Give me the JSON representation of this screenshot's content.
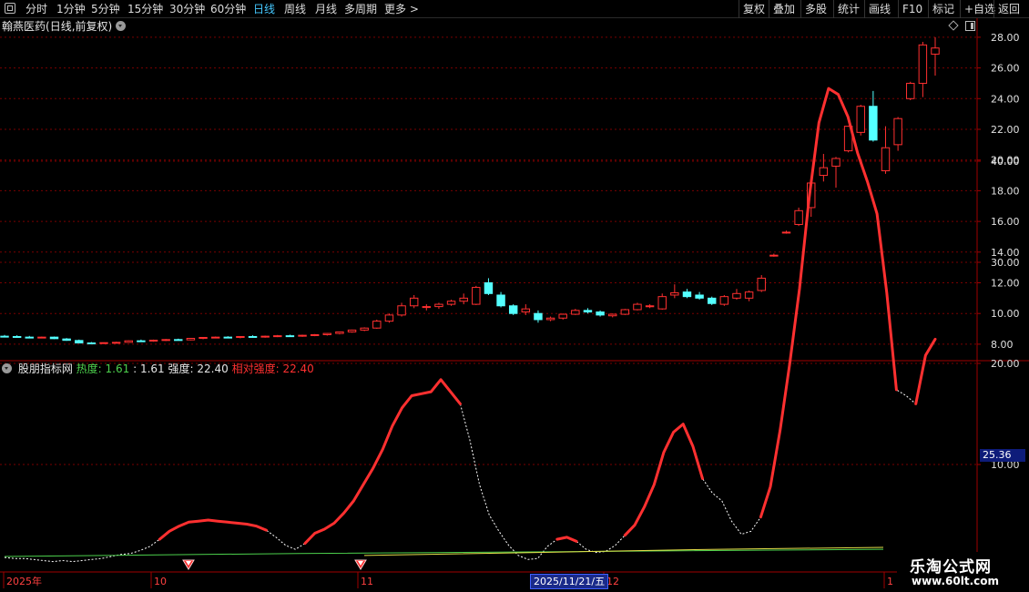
{
  "toolbar": {
    "left": [
      "分时",
      "1分钟",
      "5分钟",
      "15分钟",
      "30分钟",
      "60分钟",
      "日线",
      "周线",
      "月线",
      "多周期",
      "更多 >"
    ],
    "active": "日线",
    "right": [
      "复权",
      "叠加",
      "多股",
      "统计",
      "画线",
      "F10",
      "标记",
      "+自选",
      "返回"
    ]
  },
  "stock": {
    "name": "翰燕医药",
    "mode": "(日线,前复权)"
  },
  "indicator": {
    "name": "股朋指标网",
    "heat_label": "热度:",
    "heat_value": "1.61",
    "colon_value": ": 1.61",
    "strength_label": "强度:",
    "strength_value": "22.40",
    "rel_label": "相对强度:",
    "rel_value": "22.40",
    "last_value": "25.36"
  },
  "price_axis": [
    "28.00",
    "26.00",
    "24.00",
    "22.00",
    "20.00",
    "18.00",
    "16.00",
    "14.00",
    "12.00",
    "10.00",
    "8.00"
  ],
  "ind_axis": [
    "40.00",
    "30.00",
    "20.00",
    "10.00"
  ],
  "date_axis": [
    "2025年",
    "10",
    "11",
    "12",
    "1"
  ],
  "crosshair_date": "2025/11/21/五",
  "brand": {
    "line1": "乐淘公式网",
    "line2": "www.60lt.com"
  },
  "colors": {
    "up": "#ff3030",
    "down": "#54ffff",
    "grid": "#7a0000",
    "active": "#45c8ff",
    "heat": "#4cd04c",
    "rel": "#ff3030"
  },
  "chart_data": {
    "type": "candlestick",
    "price_range": [
      7.0,
      28.9
    ],
    "ohlc": [
      [
        8.52,
        8.6,
        8.45,
        8.5
      ],
      [
        8.5,
        8.58,
        8.42,
        8.46
      ],
      [
        8.46,
        8.54,
        8.4,
        8.44
      ],
      [
        8.42,
        8.5,
        8.38,
        8.46
      ],
      [
        8.46,
        8.5,
        8.33,
        8.36
      ],
      [
        8.34,
        8.4,
        8.22,
        8.25
      ],
      [
        8.24,
        8.3,
        8.05,
        8.08
      ],
      [
        8.08,
        8.14,
        8.02,
        8.06
      ],
      [
        8.06,
        8.12,
        8.02,
        8.1
      ],
      [
        8.1,
        8.16,
        8.05,
        8.12
      ],
      [
        8.12,
        8.25,
        8.1,
        8.22
      ],
      [
        8.22,
        8.3,
        8.15,
        8.2
      ],
      [
        8.2,
        8.3,
        8.16,
        8.26
      ],
      [
        8.26,
        8.34,
        8.2,
        8.3
      ],
      [
        8.3,
        8.36,
        8.24,
        8.28
      ],
      [
        8.28,
        8.4,
        8.25,
        8.38
      ],
      [
        8.38,
        8.46,
        8.32,
        8.44
      ],
      [
        8.44,
        8.5,
        8.38,
        8.46
      ],
      [
        8.46,
        8.52,
        8.4,
        8.44
      ],
      [
        8.44,
        8.52,
        8.38,
        8.5
      ],
      [
        8.5,
        8.58,
        8.44,
        8.48
      ],
      [
        8.48,
        8.56,
        8.42,
        8.52
      ],
      [
        8.52,
        8.6,
        8.46,
        8.55
      ],
      [
        8.55,
        8.62,
        8.5,
        8.52
      ],
      [
        8.52,
        8.62,
        8.48,
        8.58
      ],
      [
        8.58,
        8.66,
        8.52,
        8.62
      ],
      [
        8.62,
        8.72,
        8.56,
        8.7
      ],
      [
        8.7,
        8.82,
        8.64,
        8.8
      ],
      [
        8.8,
        8.95,
        8.75,
        8.92
      ],
      [
        8.92,
        9.1,
        8.85,
        9.05
      ],
      [
        9.05,
        9.6,
        9.0,
        9.5
      ],
      [
        9.5,
        10.0,
        9.4,
        9.9
      ],
      [
        9.9,
        10.7,
        9.8,
        10.5
      ],
      [
        10.5,
        11.2,
        10.35,
        11.0
      ],
      [
        10.4,
        10.6,
        10.2,
        10.45
      ],
      [
        10.45,
        10.7,
        10.3,
        10.6
      ],
      [
        10.6,
        10.9,
        10.5,
        10.8
      ],
      [
        10.8,
        11.3,
        10.6,
        11.0
      ],
      [
        10.6,
        11.8,
        10.55,
        11.7
      ],
      [
        12.0,
        12.3,
        11.2,
        11.3
      ],
      [
        11.2,
        11.4,
        10.4,
        10.5
      ],
      [
        10.5,
        10.6,
        9.9,
        10.0
      ],
      [
        10.1,
        10.6,
        9.9,
        10.3
      ],
      [
        10.0,
        10.2,
        9.4,
        9.6
      ],
      [
        9.6,
        9.8,
        9.5,
        9.7
      ],
      [
        9.7,
        10.0,
        9.6,
        9.95
      ],
      [
        9.95,
        10.3,
        9.9,
        10.2
      ],
      [
        10.2,
        10.35,
        10.0,
        10.1
      ],
      [
        10.1,
        10.2,
        9.8,
        9.9
      ],
      [
        9.85,
        10.0,
        9.75,
        9.95
      ],
      [
        9.95,
        10.3,
        9.9,
        10.25
      ],
      [
        10.25,
        10.7,
        10.2,
        10.6
      ],
      [
        10.45,
        10.6,
        10.35,
        10.5
      ],
      [
        10.3,
        11.3,
        10.25,
        11.1
      ],
      [
        11.2,
        11.9,
        11.0,
        11.35
      ],
      [
        11.4,
        11.6,
        11.0,
        11.1
      ],
      [
        11.2,
        11.4,
        10.9,
        11.0
      ],
      [
        11.0,
        11.1,
        10.55,
        10.65
      ],
      [
        10.6,
        11.2,
        10.5,
        11.1
      ],
      [
        11.0,
        11.6,
        10.9,
        11.3
      ],
      [
        11.0,
        11.5,
        10.8,
        11.4
      ],
      [
        11.5,
        12.5,
        11.4,
        12.3
      ],
      [
        13.8,
        13.9,
        13.7,
        13.8
      ],
      [
        15.3,
        15.4,
        15.2,
        15.3
      ],
      [
        15.8,
        16.9,
        15.7,
        16.7
      ],
      [
        16.9,
        18.7,
        16.3,
        18.5
      ],
      [
        19.0,
        20.4,
        18.6,
        19.5
      ],
      [
        19.6,
        20.2,
        18.2,
        20.1
      ],
      [
        20.6,
        22.1,
        20.5,
        22.2
      ],
      [
        21.8,
        23.6,
        21.6,
        23.5
      ],
      [
        23.5,
        24.5,
        21.2,
        21.3
      ],
      [
        19.3,
        22.2,
        19.1,
        20.8
      ],
      [
        21.0,
        22.8,
        20.6,
        22.7
      ],
      [
        24.0,
        25.1,
        23.9,
        25.0
      ],
      [
        25.0,
        27.7,
        24.1,
        27.5
      ],
      [
        26.9,
        28.0,
        25.5,
        27.3
      ]
    ],
    "indicator_range": [
      0,
      48.0
    ],
    "strength_line": [
      0.8,
      0.7,
      0.7,
      0.6,
      0.5,
      0.4,
      0.5,
      0.4,
      0.5,
      0.6,
      0.7,
      0.9,
      1.1,
      1.2,
      1.5,
      1.9,
      2.6,
      3.4,
      3.9,
      4.3,
      4.4,
      4.5,
      4.4,
      4.3,
      4.2,
      4.1,
      3.9,
      3.5,
      2.8,
      2.0,
      1.6,
      2.2,
      3.2,
      3.6,
      4.2,
      5.2,
      6.4,
      8.0,
      9.6,
      11.5,
      13.8,
      15.6,
      16.8,
      17.0,
      17.2,
      18.4,
      17.2,
      16.0,
      12.4,
      8.0,
      5.0,
      3.4,
      2.0,
      1.0,
      0.6,
      0.7,
      1.9,
      2.6,
      2.8,
      2.4,
      1.6,
      1.3,
      1.4,
      2.0,
      3.0,
      4.0,
      5.8,
      8.0,
      11.2,
      13.2,
      14.0,
      11.8,
      8.6,
      7.2,
      6.4,
      4.4,
      3.1,
      3.4,
      4.8,
      7.8,
      13.4,
      20.0,
      27.4,
      36.4,
      43.8,
      47.2,
      46.6,
      44.4,
      40.8,
      38.0,
      34.8,
      27.0,
      17.4,
      16.8,
      16.0,
      20.8,
      22.4
    ],
    "strong_red": [
      [
        16,
        27
      ],
      [
        31,
        47
      ],
      [
        57,
        59
      ],
      [
        64,
        72
      ],
      [
        78,
        92
      ],
      [
        94,
        97
      ]
    ],
    "heat_line": [
      0.9,
      1.2,
      1.4,
      1.61
    ],
    "ref_line": [
      1.0,
      1.3,
      1.6,
      1.8
    ]
  }
}
